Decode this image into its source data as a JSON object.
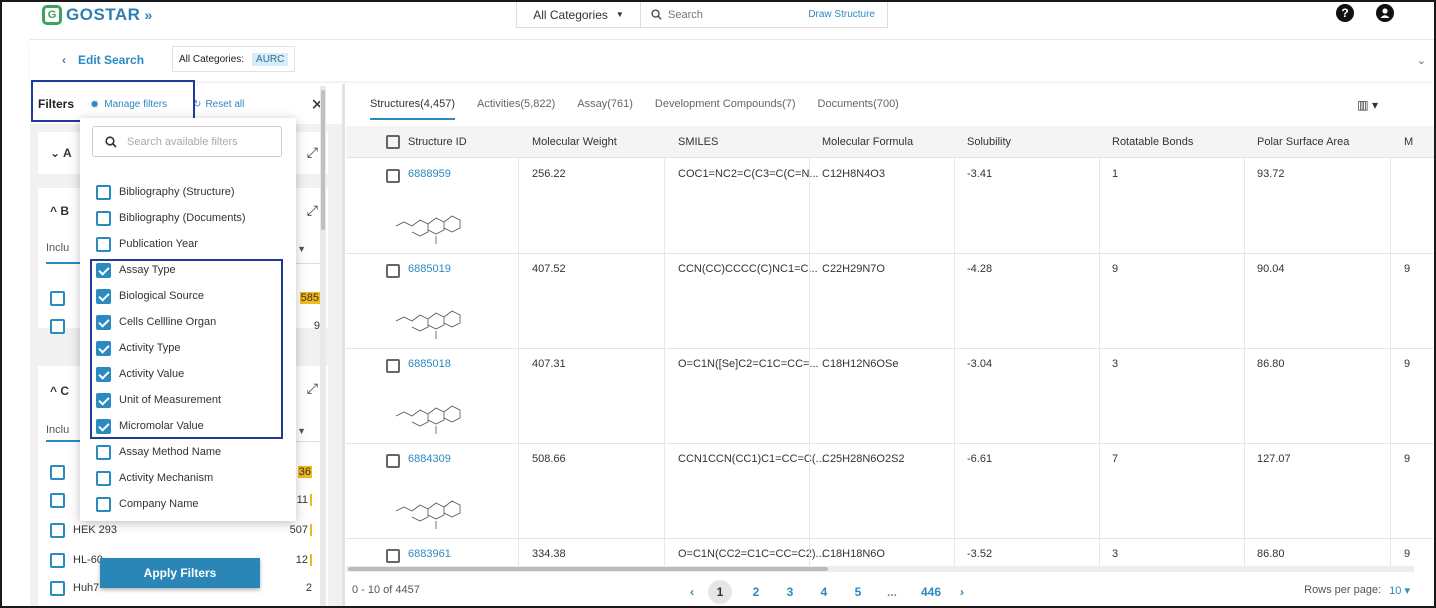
{
  "topbar": {
    "logo_text": "GOSTAR",
    "category_select": "All Categories",
    "search_placeholder": "Search",
    "draw_structure": "Draw Structure"
  },
  "subbar": {
    "edit_search": "Edit Search",
    "categories_label": "All Categories:",
    "category_chip": "AURC"
  },
  "filters": {
    "title": "Filters",
    "manage": "Manage filters",
    "reset": "Reset all",
    "card1_letter": "A",
    "card2_letter": "B",
    "card3_letter": "C",
    "include_label": "Inclu",
    "card2_counts": [
      "585",
      "9"
    ],
    "card3_items": [
      {
        "label": "",
        "count": "36"
      },
      {
        "label": "",
        "count": "11"
      },
      {
        "label": "HEK 293",
        "count": "507"
      },
      {
        "label": "HL-60",
        "count": "12"
      },
      {
        "label": "Huh7",
        "count": "2"
      }
    ],
    "apply": "Apply Filters"
  },
  "dropdown": {
    "search_placeholder": "Search available filters",
    "items": [
      {
        "label": "Bibliography (Structure)",
        "checked": false
      },
      {
        "label": "Bibliography (Documents)",
        "checked": false
      },
      {
        "label": "Publication Year",
        "checked": false
      },
      {
        "label": "Assay Type",
        "checked": true
      },
      {
        "label": "Biological Source",
        "checked": true
      },
      {
        "label": "Cells Cellline Organ",
        "checked": true
      },
      {
        "label": "Activity Type",
        "checked": true
      },
      {
        "label": "Activity Value",
        "checked": true
      },
      {
        "label": "Unit of Measurement",
        "checked": true
      },
      {
        "label": "Micromolar Value",
        "checked": true
      },
      {
        "label": "Assay Method Name",
        "checked": false
      },
      {
        "label": "Activity Mechanism",
        "checked": false
      },
      {
        "label": "Company Name",
        "checked": false
      }
    ]
  },
  "tabs": [
    "Structures(4,457)",
    "Activities(5,822)",
    "Assay(761)",
    "Development Compounds(7)",
    "Documents(700)"
  ],
  "table": {
    "headers": [
      "Structure ID",
      "Molecular Weight",
      "SMILES",
      "Molecular Formula",
      "Solubility",
      "Rotatable Bonds",
      "Polar Surface Area",
      "M"
    ],
    "rows": [
      {
        "id": "6888959",
        "mw": "256.22",
        "smiles": "COC1=NC2=C(C3=C(C=N...",
        "formula": "C12H8N4O3",
        "sol": "-3.41",
        "rot": "1",
        "psa": "93.72",
        "extra": ""
      },
      {
        "id": "6885019",
        "mw": "407.52",
        "smiles": "CCN(CC)CCCC(C)NC1=C...",
        "formula": "C22H29N7O",
        "sol": "-4.28",
        "rot": "9",
        "psa": "90.04",
        "extra": "9"
      },
      {
        "id": "6885018",
        "mw": "407.31",
        "smiles": "O=C1N([Se]C2=C1C=CC=...",
        "formula": "C18H12N6OSe",
        "sol": "-3.04",
        "rot": "3",
        "psa": "86.80",
        "extra": "9"
      },
      {
        "id": "6884309",
        "mw": "508.66",
        "smiles": "CCN1CCN(CC1)C1=CC=C(...",
        "formula": "C25H28N6O2S2",
        "sol": "-6.61",
        "rot": "7",
        "psa": "127.07",
        "extra": "9"
      },
      {
        "id": "6883961",
        "mw": "334.38",
        "smiles": "O=C1N(CC2=C1C=CC=C2)...",
        "formula": "C18H18N6O",
        "sol": "-3.52",
        "rot": "3",
        "psa": "86.80",
        "extra": "9"
      }
    ]
  },
  "footer": {
    "range": "0 - 10 of 4457",
    "pages": [
      "1",
      "2",
      "3",
      "4",
      "5",
      "...",
      "446"
    ],
    "rows_label": "Rows per page:",
    "rows_value": "10"
  }
}
